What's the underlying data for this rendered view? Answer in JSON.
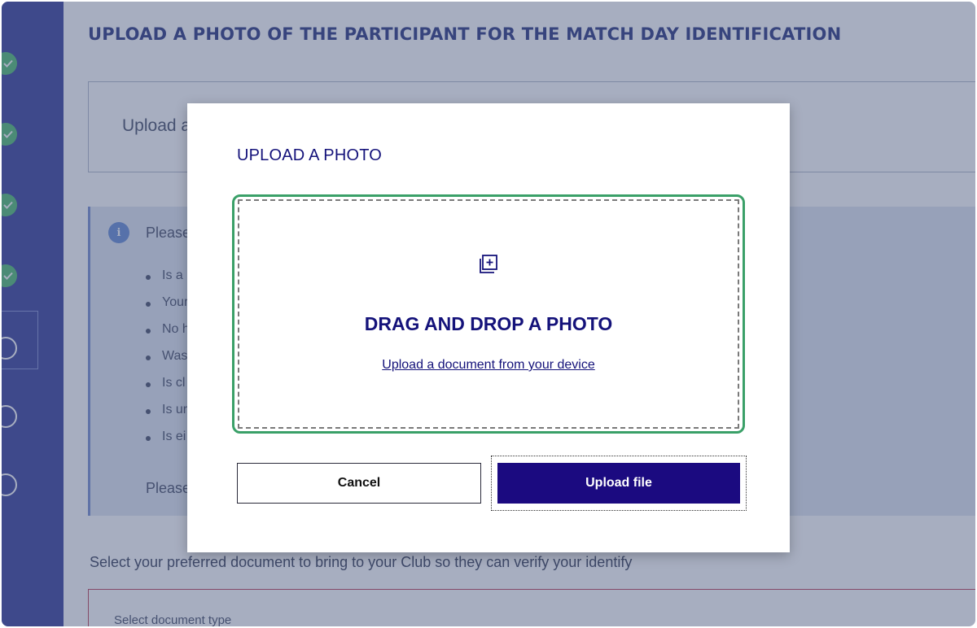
{
  "page": {
    "heading": "UPLOAD A PHOTO OF THE PARTICIPANT FOR THE MATCH DAY IDENTIFICATION",
    "upload_box_label": "Upload a",
    "info": {
      "title": "Please",
      "bullets": [
        "Is a p",
        "Your",
        "No h",
        "Was",
        "Is cl",
        "Is ur",
        "Is ei"
      ],
      "footer": "Please"
    },
    "document_select_label": "Select your preferred document to bring to your Club so they can verify your identify",
    "document_select_placeholder": "Select document type"
  },
  "sidebar": {
    "steps": [
      {
        "status": "complete"
      },
      {
        "status": "complete"
      },
      {
        "status": "complete"
      },
      {
        "status": "complete"
      },
      {
        "status": "current"
      },
      {
        "status": "incomplete"
      },
      {
        "status": "incomplete"
      }
    ]
  },
  "modal": {
    "title": "UPLOAD A PHOTO",
    "dropzone_heading": "DRAG AND DROP A PHOTO",
    "dropzone_link": "Upload a document from your device",
    "cancel_label": "Cancel",
    "upload_label": "Upload file"
  },
  "colors": {
    "brand_navy": "#1b0a80",
    "sidebar": "#2d3594",
    "success_green": "#47b86a",
    "dropzone_highlight": "#3aa068"
  }
}
